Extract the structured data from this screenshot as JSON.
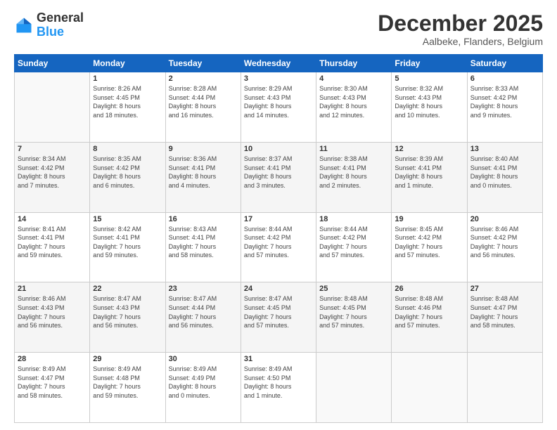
{
  "logo": {
    "general": "General",
    "blue": "Blue"
  },
  "header": {
    "month": "December 2025",
    "location": "Aalbeke, Flanders, Belgium"
  },
  "days_of_week": [
    "Sunday",
    "Monday",
    "Tuesday",
    "Wednesday",
    "Thursday",
    "Friday",
    "Saturday"
  ],
  "weeks": [
    [
      {
        "day": "",
        "info": ""
      },
      {
        "day": "1",
        "info": "Sunrise: 8:26 AM\nSunset: 4:45 PM\nDaylight: 8 hours\nand 18 minutes."
      },
      {
        "day": "2",
        "info": "Sunrise: 8:28 AM\nSunset: 4:44 PM\nDaylight: 8 hours\nand 16 minutes."
      },
      {
        "day": "3",
        "info": "Sunrise: 8:29 AM\nSunset: 4:43 PM\nDaylight: 8 hours\nand 14 minutes."
      },
      {
        "day": "4",
        "info": "Sunrise: 8:30 AM\nSunset: 4:43 PM\nDaylight: 8 hours\nand 12 minutes."
      },
      {
        "day": "5",
        "info": "Sunrise: 8:32 AM\nSunset: 4:43 PM\nDaylight: 8 hours\nand 10 minutes."
      },
      {
        "day": "6",
        "info": "Sunrise: 8:33 AM\nSunset: 4:42 PM\nDaylight: 8 hours\nand 9 minutes."
      }
    ],
    [
      {
        "day": "7",
        "info": "Sunrise: 8:34 AM\nSunset: 4:42 PM\nDaylight: 8 hours\nand 7 minutes."
      },
      {
        "day": "8",
        "info": "Sunrise: 8:35 AM\nSunset: 4:42 PM\nDaylight: 8 hours\nand 6 minutes."
      },
      {
        "day": "9",
        "info": "Sunrise: 8:36 AM\nSunset: 4:41 PM\nDaylight: 8 hours\nand 4 minutes."
      },
      {
        "day": "10",
        "info": "Sunrise: 8:37 AM\nSunset: 4:41 PM\nDaylight: 8 hours\nand 3 minutes."
      },
      {
        "day": "11",
        "info": "Sunrise: 8:38 AM\nSunset: 4:41 PM\nDaylight: 8 hours\nand 2 minutes."
      },
      {
        "day": "12",
        "info": "Sunrise: 8:39 AM\nSunset: 4:41 PM\nDaylight: 8 hours\nand 1 minute."
      },
      {
        "day": "13",
        "info": "Sunrise: 8:40 AM\nSunset: 4:41 PM\nDaylight: 8 hours\nand 0 minutes."
      }
    ],
    [
      {
        "day": "14",
        "info": "Sunrise: 8:41 AM\nSunset: 4:41 PM\nDaylight: 7 hours\nand 59 minutes."
      },
      {
        "day": "15",
        "info": "Sunrise: 8:42 AM\nSunset: 4:41 PM\nDaylight: 7 hours\nand 59 minutes."
      },
      {
        "day": "16",
        "info": "Sunrise: 8:43 AM\nSunset: 4:41 PM\nDaylight: 7 hours\nand 58 minutes."
      },
      {
        "day": "17",
        "info": "Sunrise: 8:44 AM\nSunset: 4:42 PM\nDaylight: 7 hours\nand 57 minutes."
      },
      {
        "day": "18",
        "info": "Sunrise: 8:44 AM\nSunset: 4:42 PM\nDaylight: 7 hours\nand 57 minutes."
      },
      {
        "day": "19",
        "info": "Sunrise: 8:45 AM\nSunset: 4:42 PM\nDaylight: 7 hours\nand 57 minutes."
      },
      {
        "day": "20",
        "info": "Sunrise: 8:46 AM\nSunset: 4:42 PM\nDaylight: 7 hours\nand 56 minutes."
      }
    ],
    [
      {
        "day": "21",
        "info": "Sunrise: 8:46 AM\nSunset: 4:43 PM\nDaylight: 7 hours\nand 56 minutes."
      },
      {
        "day": "22",
        "info": "Sunrise: 8:47 AM\nSunset: 4:43 PM\nDaylight: 7 hours\nand 56 minutes."
      },
      {
        "day": "23",
        "info": "Sunrise: 8:47 AM\nSunset: 4:44 PM\nDaylight: 7 hours\nand 56 minutes."
      },
      {
        "day": "24",
        "info": "Sunrise: 8:47 AM\nSunset: 4:45 PM\nDaylight: 7 hours\nand 57 minutes."
      },
      {
        "day": "25",
        "info": "Sunrise: 8:48 AM\nSunset: 4:45 PM\nDaylight: 7 hours\nand 57 minutes."
      },
      {
        "day": "26",
        "info": "Sunrise: 8:48 AM\nSunset: 4:46 PM\nDaylight: 7 hours\nand 57 minutes."
      },
      {
        "day": "27",
        "info": "Sunrise: 8:48 AM\nSunset: 4:47 PM\nDaylight: 7 hours\nand 58 minutes."
      }
    ],
    [
      {
        "day": "28",
        "info": "Sunrise: 8:49 AM\nSunset: 4:47 PM\nDaylight: 7 hours\nand 58 minutes."
      },
      {
        "day": "29",
        "info": "Sunrise: 8:49 AM\nSunset: 4:48 PM\nDaylight: 7 hours\nand 59 minutes."
      },
      {
        "day": "30",
        "info": "Sunrise: 8:49 AM\nSunset: 4:49 PM\nDaylight: 8 hours\nand 0 minutes."
      },
      {
        "day": "31",
        "info": "Sunrise: 8:49 AM\nSunset: 4:50 PM\nDaylight: 8 hours\nand 1 minute."
      },
      {
        "day": "",
        "info": ""
      },
      {
        "day": "",
        "info": ""
      },
      {
        "day": "",
        "info": ""
      }
    ]
  ]
}
